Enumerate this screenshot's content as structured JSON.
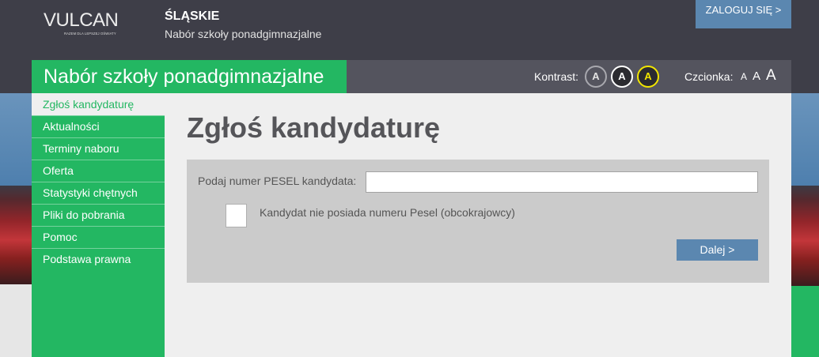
{
  "brand": {
    "logo": "VULCAN",
    "tagline": "RAZEM DLA LEPSZEJ OŚWIATY"
  },
  "header": {
    "region": "ŚLĄSKIE",
    "subtitle": "Nabór szkoły ponadgimnazjalne",
    "login_label": "ZALOGUJ SIĘ >"
  },
  "titlebar": {
    "title": "Nabór szkoły ponadgimnazjalne",
    "contrast_label": "Kontrast:",
    "contrast_options": [
      "A",
      "A",
      "A"
    ],
    "font_label": "Czcionka:",
    "font_options": [
      "A",
      "A",
      "A"
    ]
  },
  "sidebar": {
    "items": [
      {
        "label": "Zgłoś kandydaturę",
        "active": true
      },
      {
        "label": "Aktualności",
        "active": false
      },
      {
        "label": "Terminy naboru",
        "active": false
      },
      {
        "label": "Oferta",
        "active": false
      },
      {
        "label": "Statystyki chętnych",
        "active": false
      },
      {
        "label": "Pliki do pobrania",
        "active": false
      },
      {
        "label": "Pomoc",
        "active": false
      },
      {
        "label": "Podstawa prawna",
        "active": false
      }
    ]
  },
  "main": {
    "heading": "Zgłoś kandydaturę",
    "form": {
      "pesel_label": "Podaj numer PESEL kandydata:",
      "pesel_value": "",
      "no_pesel_label": "Kandydat nie posiada numeru Pesel (obcokrajowcy)",
      "no_pesel_checked": false,
      "next_label": "Dalej >"
    }
  },
  "colors": {
    "header_dark": "#3e3e48",
    "toolbar_gray": "#54545e",
    "brand_green": "#23b762",
    "accent_blue": "#5b87b0",
    "contrast_yellow": "#f2e600",
    "panel_gray": "#cbcbcb",
    "page_bg": "#efefef"
  }
}
